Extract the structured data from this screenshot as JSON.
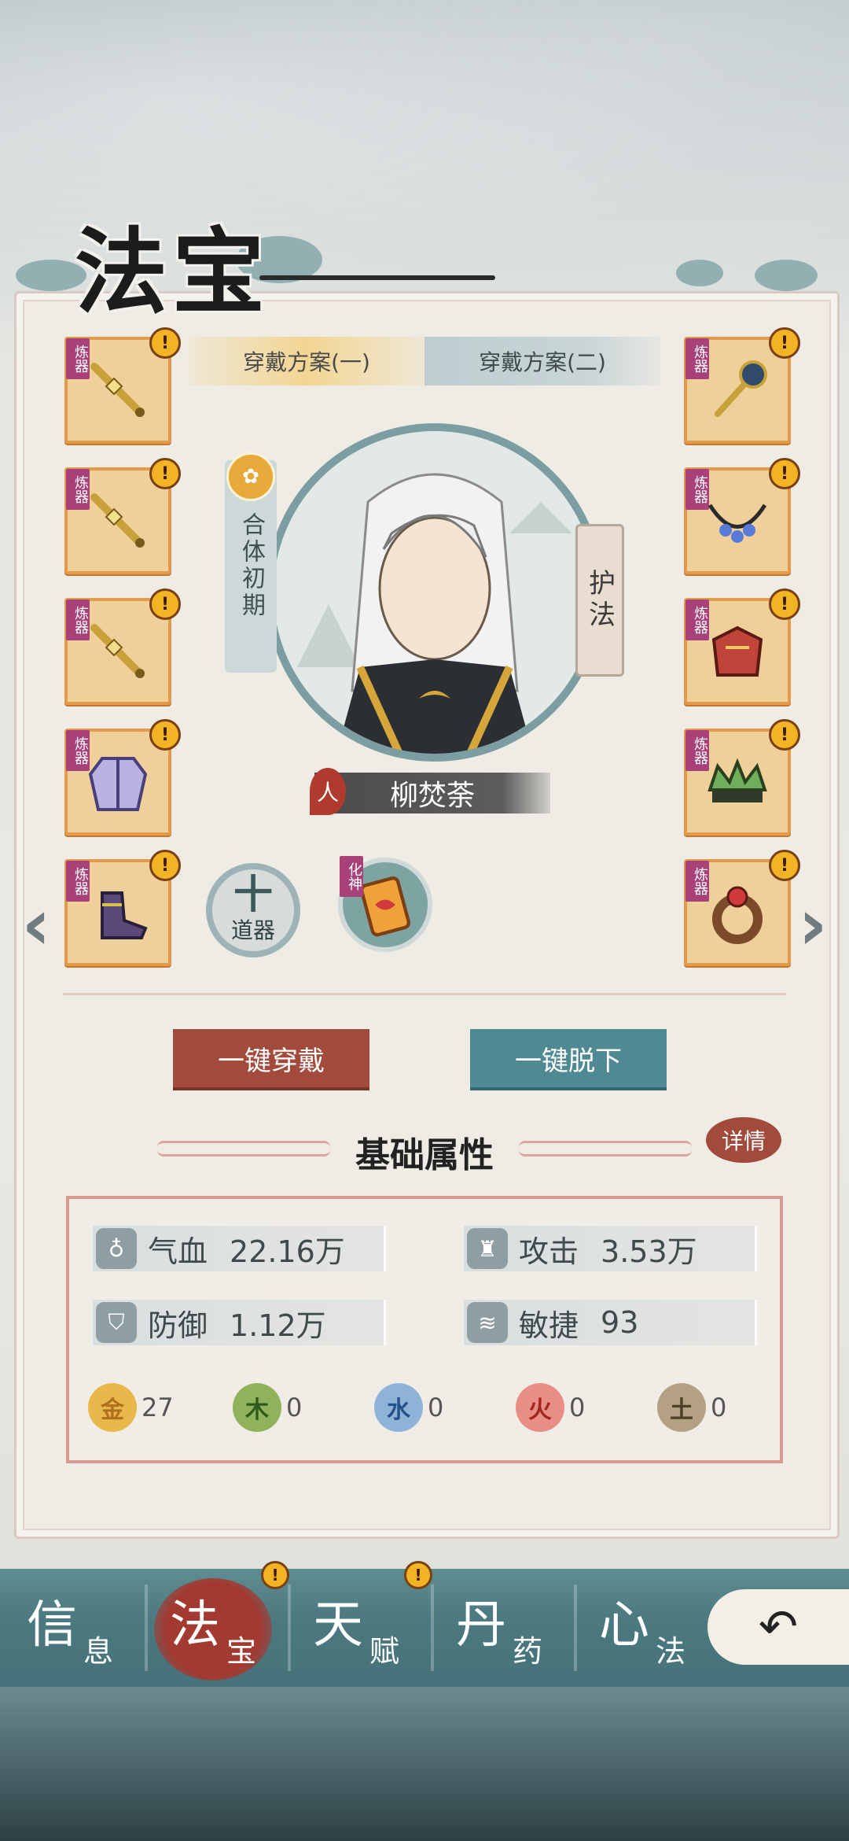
{
  "header": {
    "title": "法宝"
  },
  "tabs": [
    {
      "label": "穿戴方案(一)",
      "active": true
    },
    {
      "label": "穿戴方案(二)",
      "active": false
    }
  ],
  "slots": {
    "refine_tag": "炼器",
    "alert": "!",
    "left": [
      "sword-icon",
      "sword-icon",
      "sword-icon",
      "robe-icon",
      "boots-icon"
    ],
    "right": [
      "fan-icon",
      "necklace-icon",
      "armor-icon",
      "crown-icon",
      "ring-icon"
    ]
  },
  "character": {
    "realm": "合体初期",
    "realm_icon": "lotus-icon",
    "protect_label": "护法",
    "race": "人",
    "name": "柳焚荼"
  },
  "tool_slot": {
    "plus": "十",
    "label": "道器"
  },
  "god_slot": {
    "tag": "化神"
  },
  "buttons": {
    "wear_all": "一键穿戴",
    "remove_all": "一键脱下"
  },
  "attributes": {
    "title": "基础属性",
    "detail_label": "详情",
    "stats": [
      {
        "icon": "blood-drop-icon",
        "name": "气血",
        "value": "22.16万"
      },
      {
        "icon": "helmet-icon",
        "name": "攻击",
        "value": "3.53万"
      },
      {
        "icon": "shield-icon",
        "name": "防御",
        "value": "1.12万"
      },
      {
        "icon": "wind-icon",
        "name": "敏捷",
        "value": "93"
      }
    ],
    "elements": [
      {
        "name": "金",
        "value": "27",
        "color": "#e8b84a",
        "text_color": "#b0701e"
      },
      {
        "name": "木",
        "value": "0",
        "color": "#8fb25a",
        "text_color": "#2f5a1e"
      },
      {
        "name": "水",
        "value": "0",
        "color": "#8fb3d6",
        "text_color": "#24508c"
      },
      {
        "name": "火",
        "value": "0",
        "color": "#e88e86",
        "text_color": "#a2261c"
      },
      {
        "name": "土",
        "value": "0",
        "color": "#b4a184",
        "text_color": "#4e3f28"
      }
    ]
  },
  "nav": {
    "items": [
      {
        "big": "信",
        "small": "息",
        "active": false,
        "alert": false
      },
      {
        "big": "法",
        "small": "宝",
        "active": true,
        "alert": true
      },
      {
        "big": "天",
        "small": "赋",
        "active": false,
        "alert": true
      },
      {
        "big": "丹",
        "small": "药",
        "active": false,
        "alert": false
      },
      {
        "big": "心",
        "small": "法",
        "active": false,
        "alert": false
      }
    ],
    "back_icon": "back-arrow-icon"
  },
  "colors": {
    "accent_red": "#a24a3b",
    "accent_teal": "#4f8a93",
    "slot_bg": "#f0d09a",
    "slot_border": "#e29b4a"
  }
}
